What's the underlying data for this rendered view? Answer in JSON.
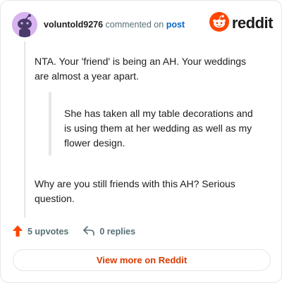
{
  "header": {
    "username": "voluntold9276",
    "commented": "commented on",
    "post_link": "post",
    "brand": "reddit"
  },
  "comment": {
    "paragraph1": "NTA. Your 'friend' is being an AH. Your weddings are almost a year apart.",
    "quote": "She has taken all my table decorations and is using them at her wedding as well as my flower design.",
    "paragraph2": "Why are you still friends with this AH? Serious question."
  },
  "actions": {
    "upvotes": "5 upvotes",
    "replies": "0 replies"
  },
  "footer": {
    "view_more": "View more on Reddit"
  },
  "colors": {
    "accent": "#ff4500",
    "link": "#0a66c2",
    "view_more": "#d93a00",
    "muted": "#576f76"
  },
  "icons": {
    "avatar": "snoo-avatar-icon",
    "brand": "reddit-logo-icon",
    "upvote": "upvote-arrow-icon",
    "reply": "reply-arrow-icon"
  }
}
